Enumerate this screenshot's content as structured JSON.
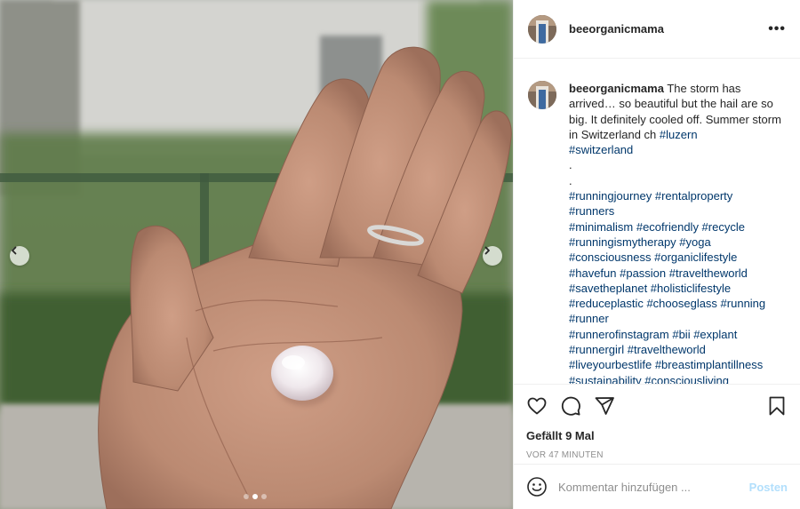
{
  "post": {
    "username": "beeorganicmama",
    "more_label": "•••",
    "caption": {
      "username": "beeorganicmama",
      "text": "The storm has arrived… so beautiful but the hail are so big. It definitely cooled off. Summer storm in Switzerland ch",
      "tags_line1": [
        "#luzern",
        "#switzerland"
      ],
      "separator1": ".",
      "separator2": ".",
      "tag_lines": [
        "#runningjourney #rentalproperty",
        "#runners",
        "#minimalism #ecofriendly #recycle",
        "#runningismytherapy #yoga",
        "#consciousness #organiclifestyle",
        "#havefun #passion #traveltheworld",
        "#savetheplanet #holisticlifestyle",
        "#reduceplastic #chooseglass #running",
        "#runner",
        "#runnerofinstagram #bii #explant",
        "#runnergirl #traveltheworld",
        "#liveyourbestlife #breastimplantillness",
        "#sustainability #consciousliving"
      ]
    },
    "likes": "Gefällt 9 Mal",
    "timestamp": "VOR 47 MINUTEN",
    "comment_placeholder": "Kommentar hinzufügen ...",
    "post_button": "Posten",
    "carousel": {
      "total": 3,
      "active": 1
    }
  },
  "icons": {
    "like": "heart-icon",
    "comment": "comment-icon",
    "share": "share-icon",
    "save": "bookmark-icon",
    "emoji": "emoji-icon",
    "prev": "chevron-left-icon",
    "next": "chevron-right-icon"
  },
  "colors": {
    "hashtag": "#00376b",
    "text": "#262626",
    "muted": "#8e8e8e",
    "post_button_disabled": "#b2dffc",
    "divider": "#efefef"
  }
}
